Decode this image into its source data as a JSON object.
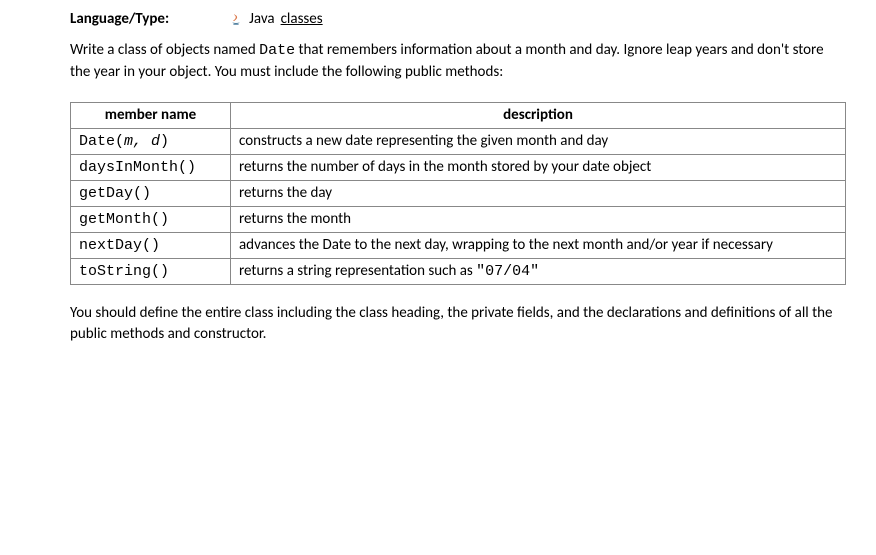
{
  "header": {
    "label": "Language/Type:",
    "language": "Java",
    "category": "classes"
  },
  "intro_parts": {
    "before_code": "Write a class of objects named ",
    "code": "Date",
    "after_code": " that remembers information about a month and day. Ignore leap years and don't store the year in your object. You must include the following public methods:"
  },
  "table": {
    "headers": [
      "member name",
      "description"
    ],
    "rows": [
      {
        "name_before_italic": "Date(",
        "name_italic": "m,  d",
        "name_after_italic": ")",
        "desc": "constructs a new date representing the given month and day"
      },
      {
        "name": "daysInMonth()",
        "desc": "returns the number of days in the month stored by your date object"
      },
      {
        "name": "getDay()",
        "desc": "returns the day"
      },
      {
        "name": "getMonth()",
        "desc": "returns the month"
      },
      {
        "name": "nextDay()",
        "desc": "advances the Date to the next day, wrapping to the next month and/or year if necessary"
      },
      {
        "name": "toString()",
        "desc_before": "returns a string representation such as ",
        "desc_code": "\"07/04\""
      }
    ]
  },
  "outro": "You should define the entire class including the class heading, the private fields, and the declarations and definitions of all the public methods and constructor."
}
